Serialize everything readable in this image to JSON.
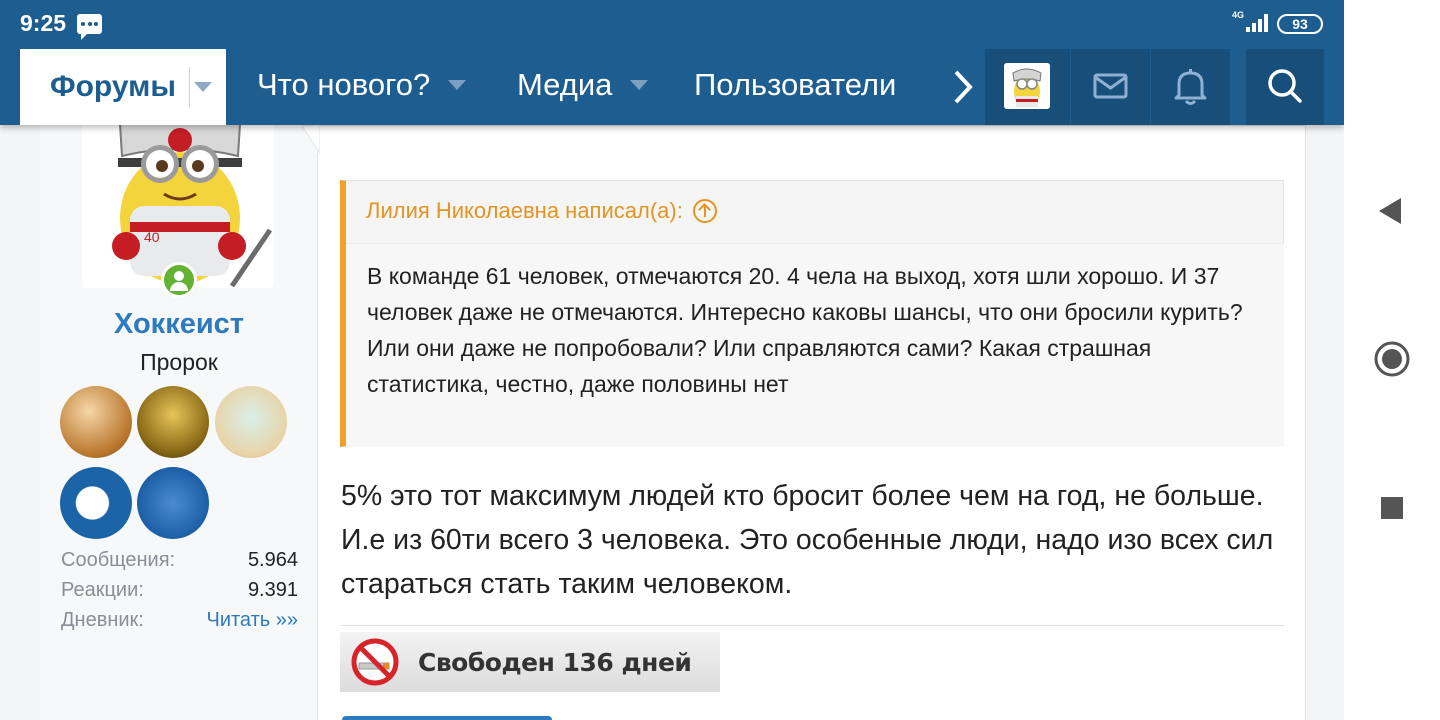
{
  "status_bar": {
    "time": "9:25",
    "network": "4G",
    "battery": "93"
  },
  "nav": {
    "forums_label": "Форумы",
    "items": [
      {
        "label": "Что нового?"
      },
      {
        "label": "Медиа"
      },
      {
        "label": "Пользователи"
      }
    ]
  },
  "colors": {
    "header": "#1d5d90",
    "accent_orange": "#f3a02a",
    "link_blue": "#2d7abf",
    "online_green": "#63b234"
  },
  "user": {
    "name": "Хоккеист",
    "title": "Пророк",
    "trophies": [
      "trophy-1",
      "trophy-2",
      "trophy-3",
      "trophy-4",
      "trophy-5"
    ],
    "stats": [
      {
        "label": "Сообщения:",
        "value": "5.964"
      },
      {
        "label": "Реакции:",
        "value": "9.391"
      },
      {
        "label": "Дневник:",
        "value": "Читать »»"
      }
    ]
  },
  "quote": {
    "author": "Лилия Николаевна написал(а):",
    "text": "В команде 61 человек, отмечаются 20. 4 чела на выход, хотя шли хорошо. И 37 человек даже не отмечаются. Интересно каковы шансы, что они бросили курить? Или они даже не попробовали? Или справляются сами? Какая страшная статистика, честно, даже половины нет"
  },
  "post": {
    "text": "5% это тот максимум людей кто бросит более чем на год, не больше. И.е из 60ти всего 3 человека. Это особенные люди, надо изо всех сил стараться стать таким человеком."
  },
  "signature": {
    "label": "Свободен 136 дней"
  }
}
